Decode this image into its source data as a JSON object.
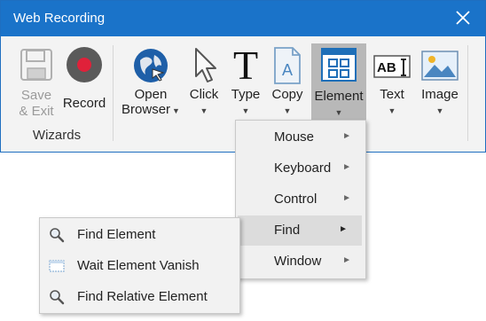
{
  "window": {
    "title": "Web Recording"
  },
  "toolbar": {
    "save_exit": {
      "line1": "Save",
      "line2": "& Exit"
    },
    "record": {
      "label": "Record"
    },
    "wizards_label": "Wizards",
    "open_browser": {
      "line1": "Open",
      "line2": "Browser"
    },
    "click": {
      "label": "Click"
    },
    "type": {
      "label": "Type"
    },
    "copy": {
      "label": "Copy"
    },
    "element": {
      "label": "Element"
    },
    "text": {
      "label": "Text"
    },
    "image": {
      "label": "Image"
    }
  },
  "element_menu": {
    "items": [
      {
        "label": "Mouse"
      },
      {
        "label": "Keyboard"
      },
      {
        "label": "Control"
      },
      {
        "label": "Find"
      },
      {
        "label": "Window"
      }
    ]
  },
  "find_submenu": {
    "items": [
      {
        "label": "Find Element"
      },
      {
        "label": "Wait Element Vanish"
      },
      {
        "label": "Find Relative Element"
      }
    ]
  },
  "colors": {
    "titlebar": "#1a73c9",
    "record_red": "#e0213a",
    "ribbon_bg": "#f3f3f3",
    "highlight": "#b8b8b8"
  }
}
